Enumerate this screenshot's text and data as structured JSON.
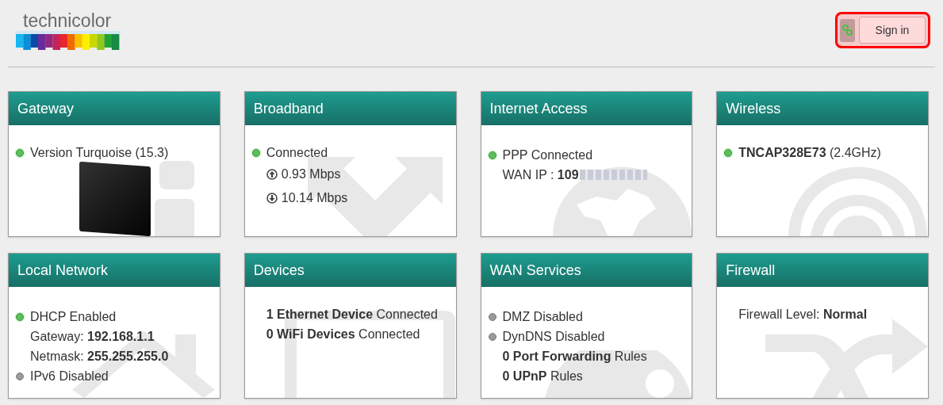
{
  "header": {
    "logo_text": "technicolor",
    "sign_in": "Sign in"
  },
  "cards": [
    {
      "title": "Gateway",
      "lines": [
        {
          "kind": "status",
          "on": true,
          "text": "Version Turquoise (15.3)"
        }
      ],
      "router_image": true
    },
    {
      "title": "Broadband",
      "lines": [
        {
          "kind": "status",
          "on": true,
          "text": "Connected"
        },
        {
          "kind": "upload",
          "text": "0.93 Mbps"
        },
        {
          "kind": "download",
          "text": "10.14 Mbps"
        }
      ]
    },
    {
      "title": "Internet Access",
      "lines": [
        {
          "kind": "status",
          "on": true,
          "text": "PPP Connected"
        },
        {
          "kind": "redacted",
          "text": "WAN IP : **109**"
        }
      ]
    },
    {
      "title": "Wireless",
      "lines": [
        {
          "kind": "status",
          "on": true,
          "text": "**TNCAP328E73** (2.4GHz)"
        }
      ]
    },
    {
      "title": "Local Network",
      "lines": [
        {
          "kind": "status",
          "on": true,
          "text": "DHCP Enabled"
        },
        {
          "kind": "detail",
          "text": "Gateway: **192.168.1.1**"
        },
        {
          "kind": "detail",
          "text": "Netmask: **255.255.255.0**"
        },
        {
          "kind": "status",
          "on": false,
          "text": "IPv6 Disabled"
        }
      ]
    },
    {
      "title": "Devices",
      "lines": [
        {
          "kind": "detail",
          "text": "**1 Ethernet Device** Connected"
        },
        {
          "kind": "detail",
          "text": "**0 WiFi Devices** Connected"
        }
      ]
    },
    {
      "title": "WAN Services",
      "lines": [
        {
          "kind": "status",
          "on": false,
          "text": "DMZ Disabled"
        },
        {
          "kind": "status",
          "on": false,
          "text": "DynDNS Disabled"
        },
        {
          "kind": "detail",
          "text": "**0 Port Forwarding** Rules"
        },
        {
          "kind": "detail",
          "text": "**0 UPnP** Rules"
        }
      ]
    },
    {
      "title": "Firewall",
      "lines": [
        {
          "kind": "detail",
          "text": "Firewall Level: **Normal**"
        }
      ]
    }
  ]
}
